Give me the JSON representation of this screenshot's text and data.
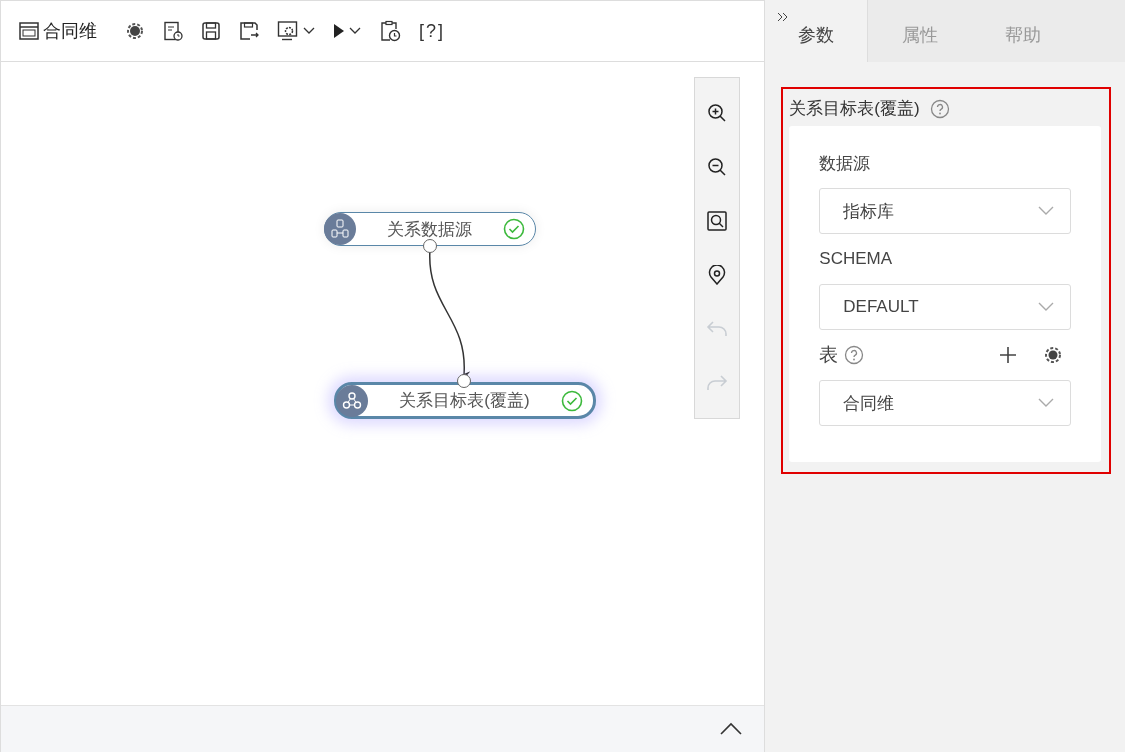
{
  "toolbar": {
    "title": "合同维",
    "help_label": "[?]"
  },
  "canvas": {
    "nodes": [
      {
        "label": "关系数据源",
        "kind": "source",
        "valid": true,
        "selected": false
      },
      {
        "label": "关系目标表(覆盖)",
        "kind": "target",
        "valid": true,
        "selected": true
      }
    ],
    "zoom_tools": [
      {
        "kind": "zoom-in",
        "disabled": false
      },
      {
        "kind": "zoom-out",
        "disabled": false
      },
      {
        "kind": "fit",
        "disabled": false
      },
      {
        "kind": "locate",
        "disabled": false
      },
      {
        "kind": "undo",
        "disabled": true
      },
      {
        "kind": "redo",
        "disabled": true
      }
    ]
  },
  "panel": {
    "tabs": [
      {
        "label": "参数",
        "selected": true
      },
      {
        "label": "属性",
        "selected": false
      },
      {
        "label": "帮助",
        "selected": false
      }
    ],
    "section": {
      "title": "关系目标表(覆盖)",
      "highlighted": true,
      "fields": [
        {
          "label": "数据源",
          "value": "指标库",
          "actions": false
        },
        {
          "label": "SCHEMA",
          "value": "DEFAULT",
          "actions": false
        },
        {
          "label": "表",
          "value": "合同维",
          "actions": true
        }
      ]
    }
  }
}
